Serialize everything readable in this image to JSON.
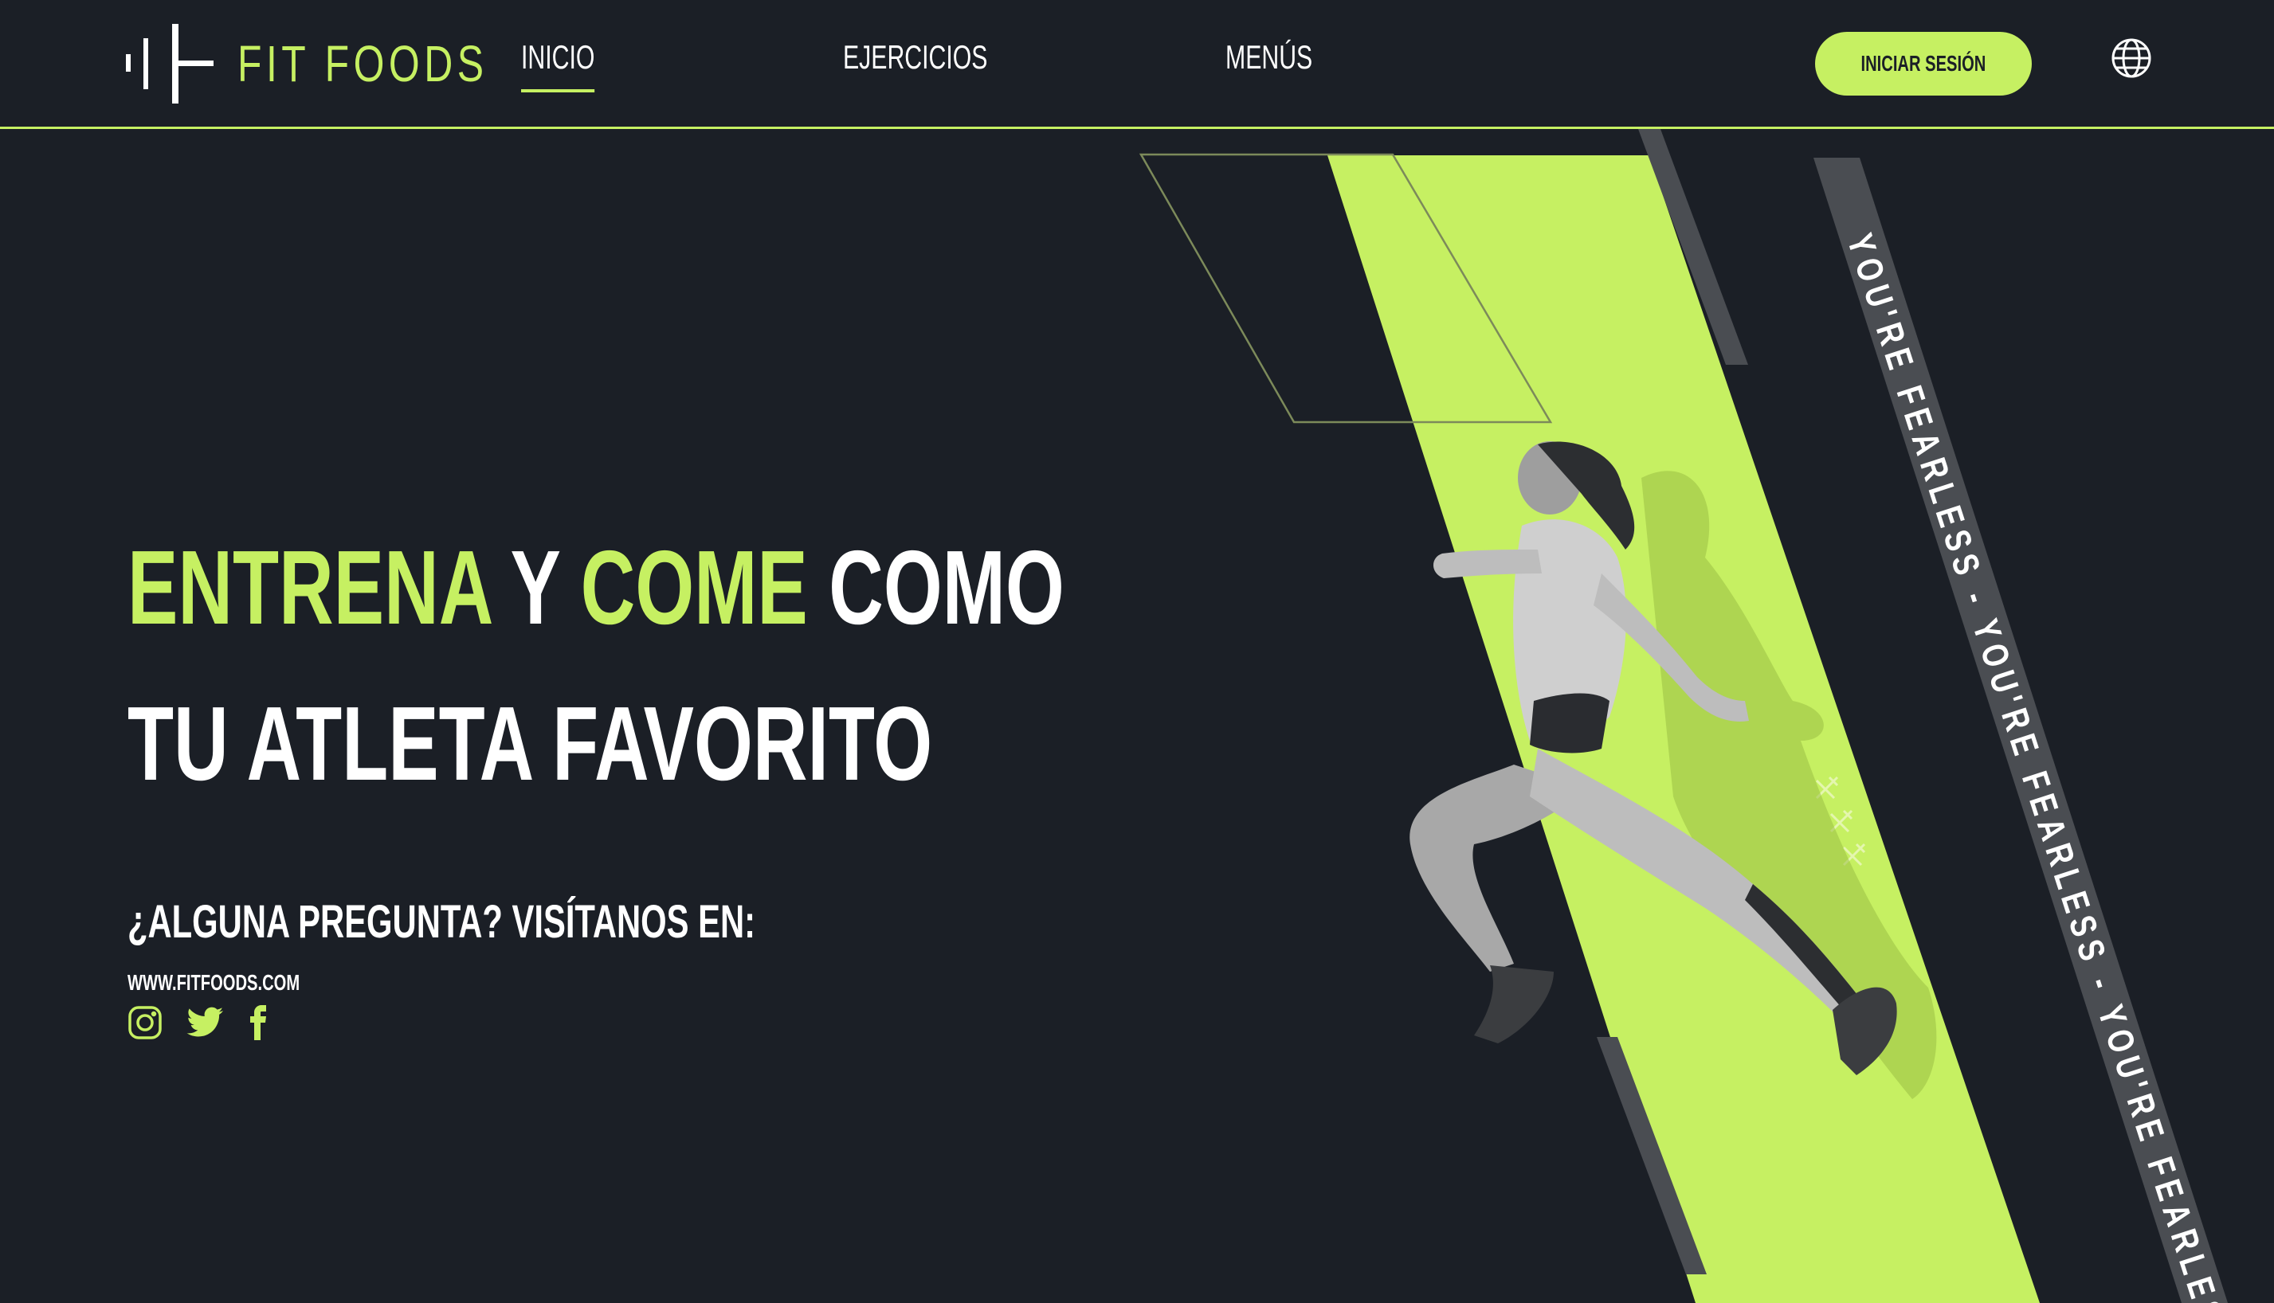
{
  "brand": {
    "name": "FIT FOODS",
    "logo_icon": "barbell-logo-icon"
  },
  "nav": {
    "items": [
      {
        "label": "INICIO",
        "active": true
      },
      {
        "label": "EJERCICIOS",
        "active": false
      },
      {
        "label": "MENÚS",
        "active": false
      }
    ],
    "login_label": "INICIAR SESIÓN",
    "language_icon": "globe-icon"
  },
  "hero": {
    "line1": {
      "word1": "ENTRENA",
      "word2": "Y",
      "word3": "COME",
      "word4": "COMO"
    },
    "line2": "TU ATLETA FAVORITO",
    "question": "¿ALGUNA PREGUNTA? VISÍTANOS EN:",
    "website": "WWW.FITFOODS.COM",
    "socials": [
      "instagram-icon",
      "twitter-icon",
      "facebook-icon"
    ]
  },
  "band_text": "YOU'RE FEARLESS - YOU'RE FEARLESS - YOU'RE FEARLESS",
  "colors": {
    "background": "#1b1f26",
    "accent": "#c6f062",
    "band": "#4a4d52"
  }
}
